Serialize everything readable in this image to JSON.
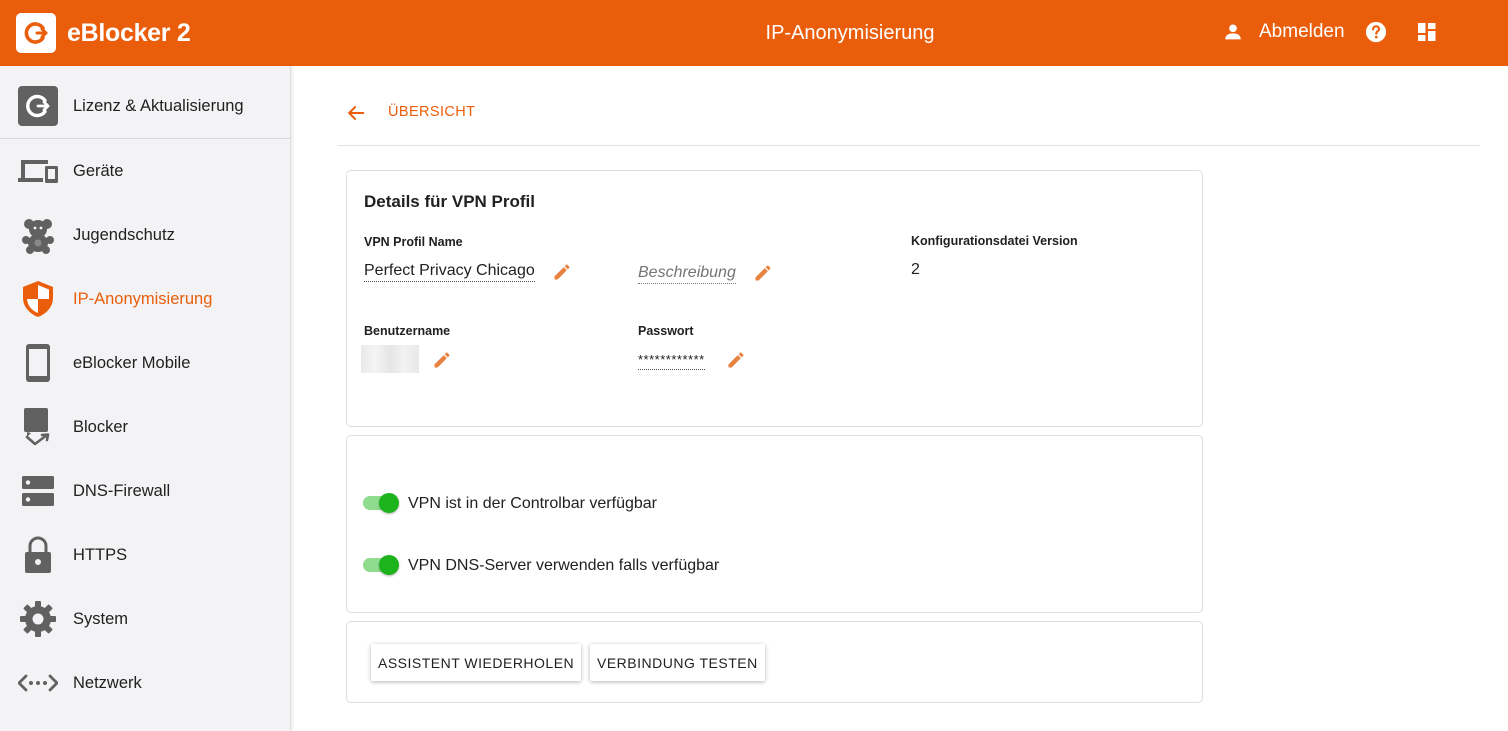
{
  "header": {
    "brand": "eBlocker 2",
    "title": "IP-Anonymisierung",
    "logout_label": "Abmelden",
    "accent_color": "#ea5e0b"
  },
  "sidebar": {
    "items": [
      {
        "label": "Lizenz & Aktualisierung",
        "icon": "license-update-icon"
      },
      {
        "label": "Geräte",
        "icon": "devices-icon"
      },
      {
        "label": "Jugendschutz",
        "icon": "teddy-bear-icon"
      },
      {
        "label": "IP-Anonymisierung",
        "icon": "shield-icon",
        "active": true
      },
      {
        "label": "eBlocker Mobile",
        "icon": "phone-icon"
      },
      {
        "label": "Blocker",
        "icon": "blocker-icon"
      },
      {
        "label": "DNS-Firewall",
        "icon": "server-icon"
      },
      {
        "label": "HTTPS",
        "icon": "lock-icon"
      },
      {
        "label": "System",
        "icon": "gear-icon"
      },
      {
        "label": "Netzwerk",
        "icon": "network-icon"
      }
    ]
  },
  "nav": {
    "back_label": "ÜBERSICHT"
  },
  "details": {
    "title": "Details für VPN Profil",
    "name_label": "VPN Profil Name",
    "name_value": "Perfect Privacy Chicago",
    "description_placeholder": "Beschreibung",
    "config_version_label": "Konfigurationsdatei Version",
    "config_version_value": "2",
    "username_label": "Benutzername",
    "password_label": "Passwort",
    "password_value": "************"
  },
  "options": {
    "controlbar_label": "VPN ist in der Controlbar verfügbar",
    "controlbar_enabled": true,
    "dns_label": "VPN DNS-Server verwenden falls verfügbar",
    "dns_enabled": true
  },
  "actions": {
    "wizard_label": "ASSISTENT WIEDERHOLEN",
    "test_label": "VERBINDUNG TESTEN"
  }
}
